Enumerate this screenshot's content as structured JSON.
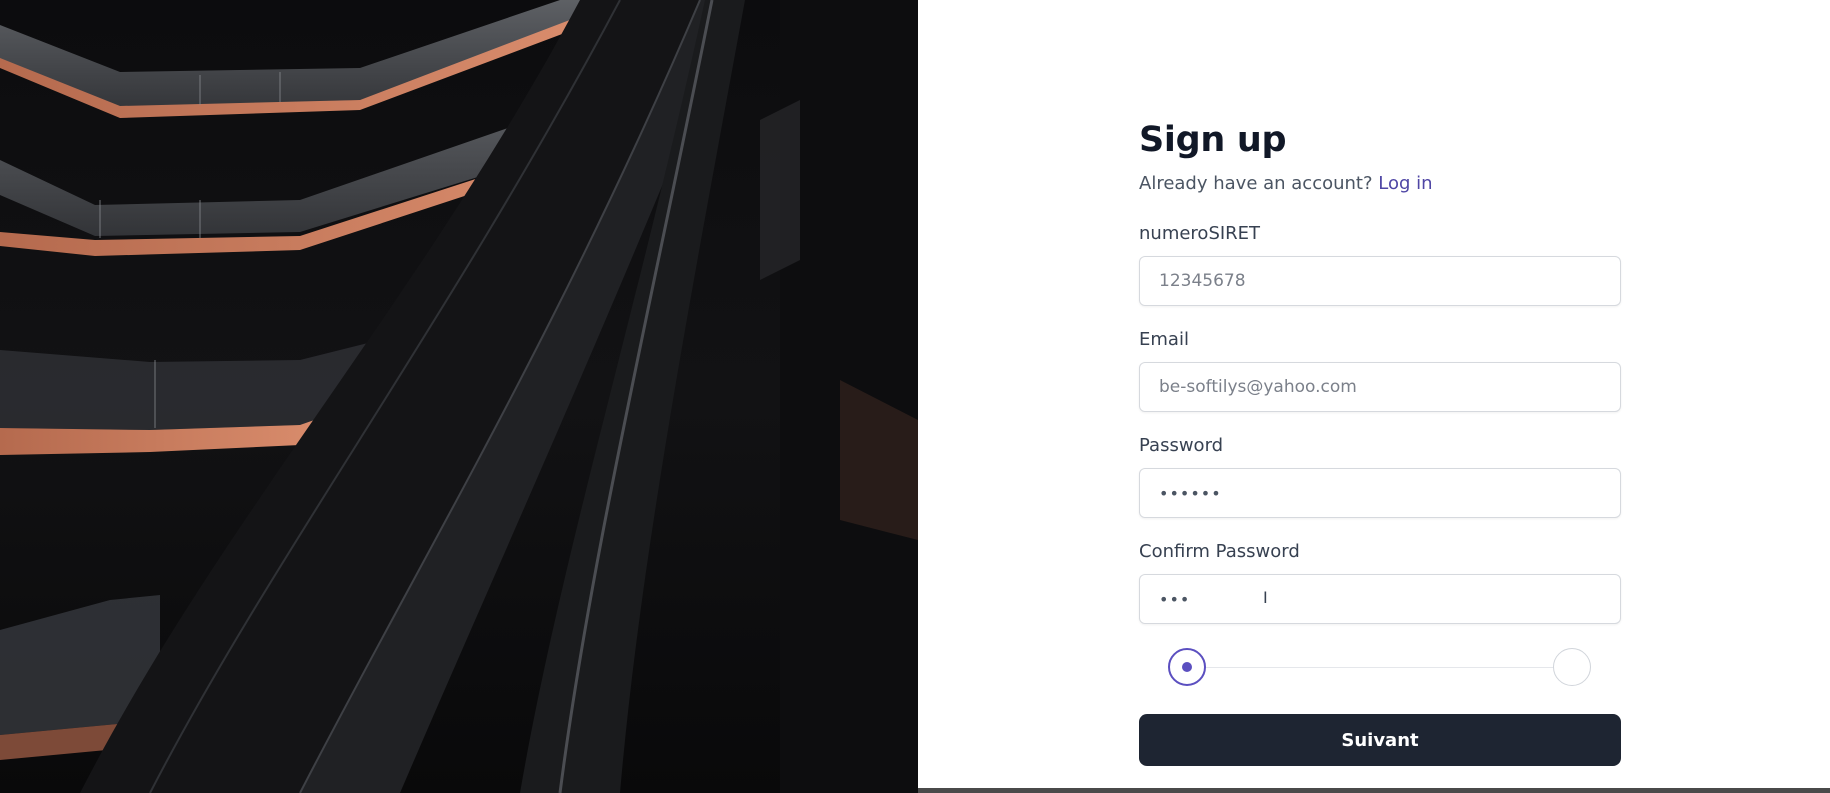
{
  "signup": {
    "title": "Sign up",
    "subtitle_text": "Already have an account?",
    "login_link": "Log in",
    "fields": [
      {
        "label": "numeroSIRET",
        "placeholder": "12345678",
        "value": ""
      },
      {
        "label": "Email",
        "placeholder": "be-softilys@yahoo.com",
        "value": ""
      },
      {
        "label": "Password",
        "placeholder": "",
        "value": "••••••"
      },
      {
        "label": "Confirm Password",
        "placeholder": "",
        "value": "•••"
      }
    ],
    "stepper": {
      "current_step": 1,
      "total_steps": 2
    },
    "submit_label": "Suivant"
  },
  "colors": {
    "accent": "#5b4fc0",
    "link": "#4f46a5",
    "button_bg": "#1e2532"
  }
}
